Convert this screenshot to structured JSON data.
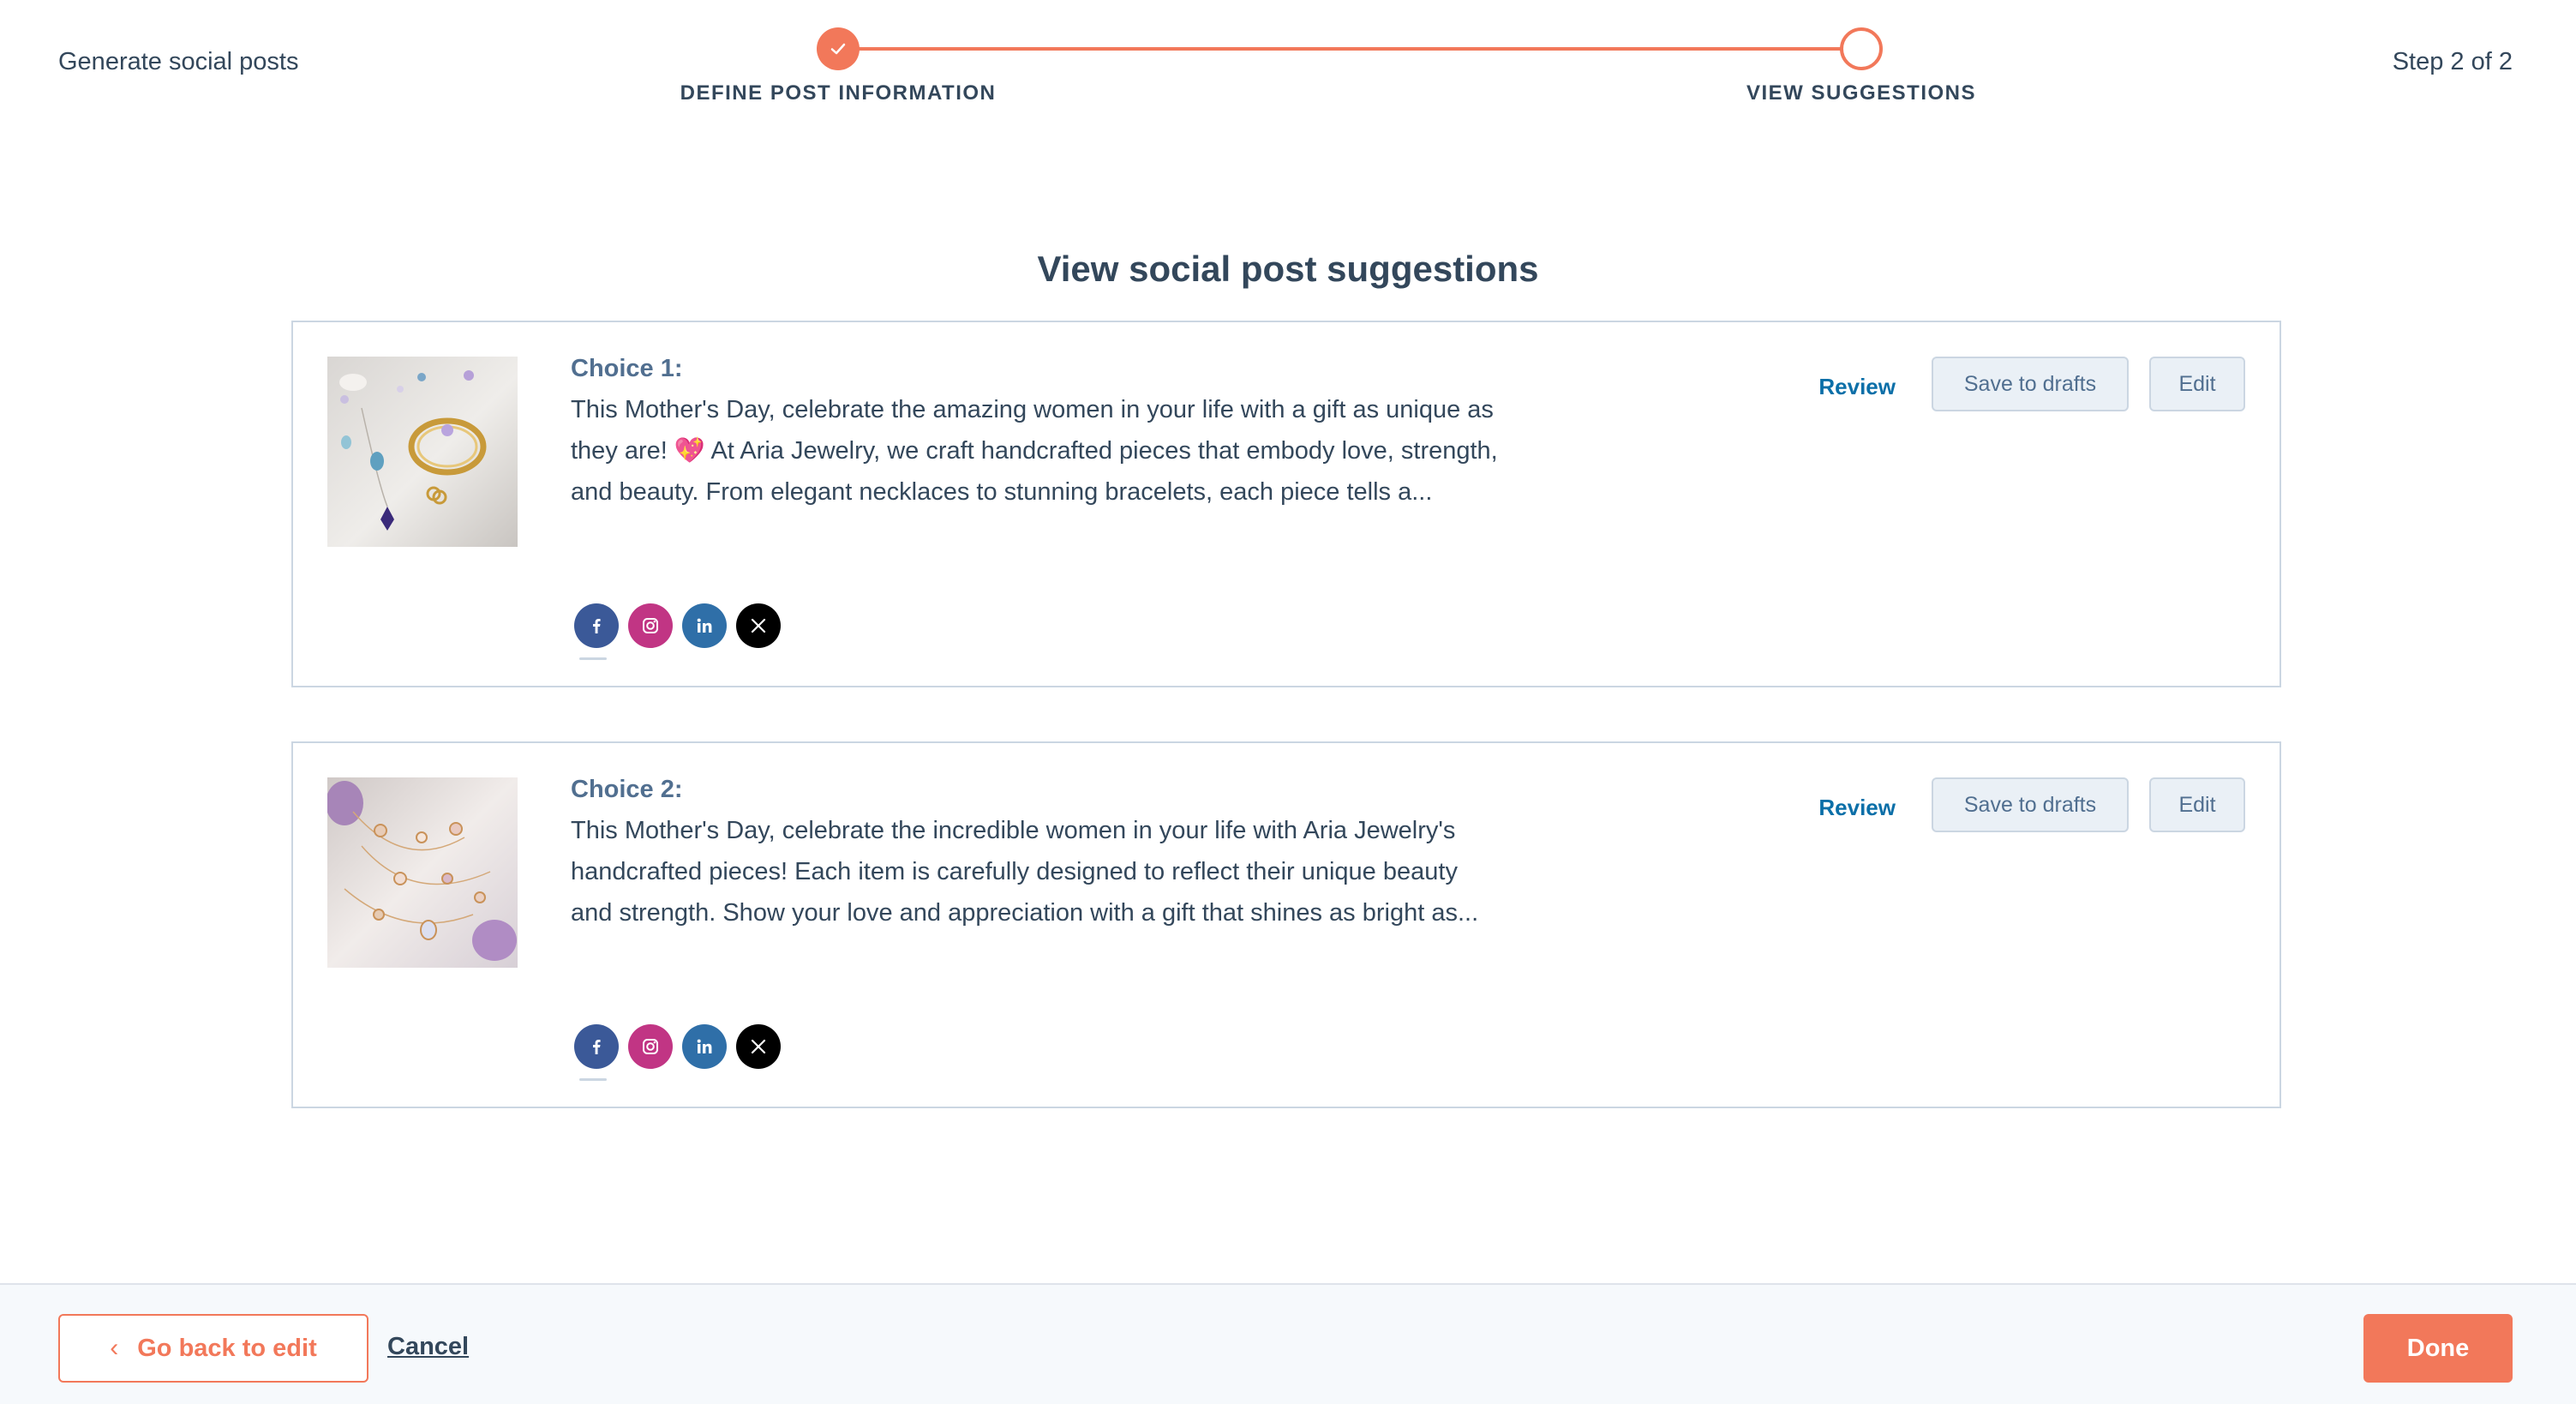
{
  "header": {
    "app_title": "Generate social posts",
    "step_count": "Step 2 of 2",
    "steps": [
      {
        "label": "DEFINE POST INFORMATION",
        "status": "complete"
      },
      {
        "label": "VIEW SUGGESTIONS",
        "status": "current"
      }
    ]
  },
  "main": {
    "heading": "View social post suggestions",
    "cards": [
      {
        "title": "Choice 1:",
        "text": "This Mother's Day, celebrate the amazing women in your life with a gift as unique as they are! 💖 At Aria Jewelry, we craft handcrafted pieces that embody love, strength, and beauty. From elegant necklaces to stunning bracelets, each piece tells a...",
        "review_label": "Review",
        "drafts_label": "Save to drafts",
        "edit_label": "Edit",
        "networks": [
          "facebook-icon",
          "instagram-icon",
          "linkedin-icon",
          "x-icon"
        ]
      },
      {
        "title": "Choice 2:",
        "text": "This Mother's Day, celebrate the incredible women in your life with Aria Jewelry's handcrafted pieces! Each item is carefully designed to reflect their unique beauty and strength. Show your love and appreciation with a gift that shines as bright as...",
        "review_label": "Review",
        "drafts_label": "Save to drafts",
        "edit_label": "Edit",
        "networks": [
          "facebook-icon",
          "instagram-icon",
          "linkedin-icon",
          "x-icon"
        ]
      }
    ]
  },
  "footer": {
    "back_label": "Go back to edit",
    "cancel_label": "Cancel",
    "done_label": "Done"
  },
  "colors": {
    "accent": "#f2785a",
    "text": "#33475b",
    "link": "#0b6fa8",
    "border": "#cbd6e2"
  }
}
